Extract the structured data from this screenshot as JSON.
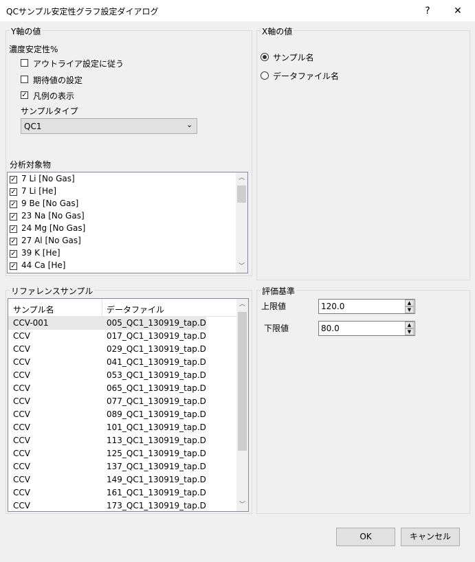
{
  "window": {
    "title": "QCサンプル安定性グラフ設定ダイアログ",
    "help": "?",
    "close": "✕"
  },
  "y_axis": {
    "group_label": "Y軸の値",
    "heading": "濃度安定性%",
    "options": [
      {
        "label": "アウトライア設定に従う",
        "checked": false
      },
      {
        "label": "期待値の設定",
        "checked": false
      },
      {
        "label": "凡例の表示",
        "checked": true
      }
    ],
    "sample_type_label": "サンプルタイプ",
    "sample_type_value": "QC1",
    "analytes_label": "分析対象物",
    "analytes": [
      "7 Li [No Gas]",
      "7 Li [He]",
      "9 Be [No Gas]",
      "23 Na [No Gas]",
      "24 Mg [No Gas]",
      "27 Al [No Gas]",
      "39 K [He]",
      "44 Ca [He]"
    ]
  },
  "x_axis": {
    "group_label": "X軸の値",
    "options": [
      {
        "label": "サンプル名",
        "selected": true
      },
      {
        "label": "データファイル名",
        "selected": false
      }
    ]
  },
  "reference": {
    "group_label": "リファレンスサンプル",
    "columns": [
      "サンプル名",
      "データファイル"
    ],
    "rows": [
      [
        "CCV-001",
        "005_QC1_130919_tap.D"
      ],
      [
        "CCV",
        "017_QC1_130919_tap.D"
      ],
      [
        "CCV",
        "029_QC1_130919_tap.D"
      ],
      [
        "CCV",
        "041_QC1_130919_tap.D"
      ],
      [
        "CCV",
        "053_QC1_130919_tap.D"
      ],
      [
        "CCV",
        "065_QC1_130919_tap.D"
      ],
      [
        "CCV",
        "077_QC1_130919_tap.D"
      ],
      [
        "CCV",
        "089_QC1_130919_tap.D"
      ],
      [
        "CCV",
        "101_QC1_130919_tap.D"
      ],
      [
        "CCV",
        "113_QC1_130919_tap.D"
      ],
      [
        "CCV",
        "125_QC1_130919_tap.D"
      ],
      [
        "CCV",
        "137_QC1_130919_tap.D"
      ],
      [
        "CCV",
        "149_QC1_130919_tap.D"
      ],
      [
        "CCV",
        "161_QC1_130919_tap.D"
      ],
      [
        "CCV",
        "173_QC1_130919_tap.D"
      ]
    ]
  },
  "criteria": {
    "group_label": "評価基準",
    "upper_label": "上限値",
    "upper_value": "120.0",
    "lower_label": "下限値",
    "lower_value": "80.0"
  },
  "buttons": {
    "ok": "OK",
    "cancel": "キャンセル"
  },
  "icons": {
    "checkbox_check": "check-mark",
    "dropdown": "chevron-down-icon",
    "scroll_up": "scroll-up-icon",
    "scroll_down": "scroll-down-icon"
  }
}
